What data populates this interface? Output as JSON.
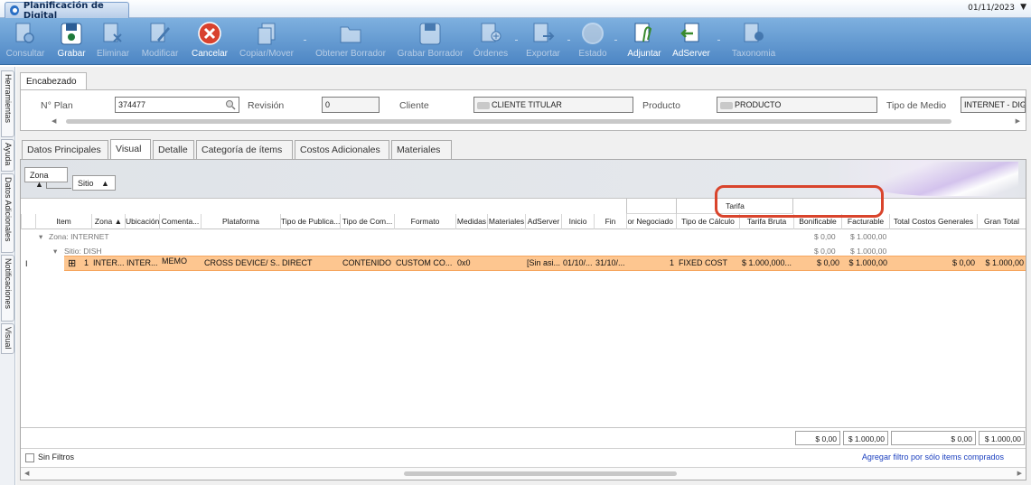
{
  "window": {
    "tab_title": "Planificación de Digital",
    "date": "01/11/2023",
    "menu_arrow": "▼"
  },
  "toolbar": {
    "buttons": [
      {
        "label": "Consultar",
        "icon": "search-doc-icon",
        "enabled": false
      },
      {
        "label": "Grabar",
        "icon": "save-icon",
        "enabled": true
      },
      {
        "label": "Eliminar",
        "icon": "delete-doc-icon",
        "enabled": false
      },
      {
        "label": "Modificar",
        "icon": "edit-icon",
        "enabled": false
      },
      {
        "label": "Cancelar",
        "icon": "cancel-icon",
        "enabled": true
      },
      {
        "label": "Copiar/Mover",
        "icon": "copy-icon",
        "enabled": false
      },
      {
        "label": "Obtener Borrador",
        "icon": "folder-icon",
        "enabled": false
      },
      {
        "label": "Grabar Borrador",
        "icon": "save-draft-icon",
        "enabled": false
      },
      {
        "label": "Órdenes",
        "icon": "orders-icon",
        "enabled": false
      },
      {
        "label": "Exportar",
        "icon": "export-icon",
        "enabled": false
      },
      {
        "label": "Estado",
        "icon": "status-icon",
        "enabled": false
      },
      {
        "label": "Adjuntar",
        "icon": "attach-icon",
        "enabled": true
      },
      {
        "label": "AdServer",
        "icon": "adserver-icon",
        "enabled": true
      },
      {
        "label": "Taxonomia",
        "icon": "taxonomy-icon",
        "enabled": false
      }
    ]
  },
  "sidebar": {
    "tabs": [
      "Herramientas",
      "Ayuda",
      "Datos Adicionales",
      "Notificaciones",
      "Visual"
    ]
  },
  "header": {
    "tab": "Encabezado",
    "plan_label": "N° Plan",
    "plan_value": "374477",
    "revision_label": "Revisión",
    "revision_value": "0",
    "cliente_label": "Cliente",
    "cliente_value": "CLIENTE TITULAR",
    "producto_label": "Producto",
    "producto_value": "PRODUCTO",
    "tipo_medio_label": "Tipo de Medio",
    "tipo_medio_value": "INTERNET - DIGI"
  },
  "tabs": [
    {
      "label": "Datos Principales",
      "active": false
    },
    {
      "label": "Visual",
      "active": true
    },
    {
      "label": "Detalle",
      "active": false
    },
    {
      "label": "Categoría de ítems",
      "active": false
    },
    {
      "label": "Costos Adicionales",
      "active": false
    },
    {
      "label": "Materiales",
      "active": false
    }
  ],
  "grouping": {
    "zona": "Zona",
    "sitio": "Sitio",
    "sort": "▲"
  },
  "grid": {
    "band_tarifa": "Tarifa",
    "columns": [
      "Item",
      "Zona",
      "Ubicación",
      "Comenta...",
      "Plataforma",
      "Tipo de Publica...",
      "Tipo de Com...",
      "Formato",
      "Medidas",
      "Materiales",
      "AdServer",
      "Inicio",
      "Fin",
      "or Negociado",
      "Tipo de Cálculo",
      "Tarifa Bruta",
      "Bonificable",
      "Facturable",
      "Total Costos Generales",
      "Gran Total"
    ],
    "zona_sort": "▲",
    "group_zona": "Zona: INTERNET",
    "group_zona_bon": "$ 0,00",
    "group_zona_fac": "$ 1.000,00",
    "group_sitio": "Sitio: DISH",
    "group_sitio_bon": "$ 0,00",
    "group_sitio_fac": "$ 1.000,00",
    "row": {
      "cursor": "I",
      "expand": "⊞",
      "item": "1",
      "zona": "INTER...",
      "ubicacion": "INTER...",
      "comentario": "MEMO",
      "plataforma": "CROSS DEVICE/ S...",
      "tipo_publicacion": "DIRECT",
      "tipo_compra": "CONTENIDO",
      "formato": "CUSTOM CO...",
      "medidas": "0x0",
      "materiales": "",
      "adserver": "[Sin asi...",
      "inicio": "01/10/...",
      "fin": "31/10/...",
      "negociado": "1",
      "tipo_calculo": "FIXED COST",
      "tarifa_bruta": "$ 1.000,000...",
      "bonificable": "$ 0,00",
      "facturable": "$ 1.000,00",
      "total_costos": "$ 0,00",
      "gran_total": "$ 1.000,00"
    },
    "totals": {
      "bonificable": "$ 0,00",
      "facturable": "$ 1.000,00",
      "total_costos": "$ 0,00",
      "gran_total": "$ 1.000,00"
    }
  },
  "filter": {
    "sin_filtros": "Sin Filtros",
    "agregar": "Agregar filtro por sólo items comprados"
  },
  "colors": {
    "row_highlight": "#fdc690",
    "toolbar": "#5b93cf",
    "annotation": "#d9442c"
  }
}
